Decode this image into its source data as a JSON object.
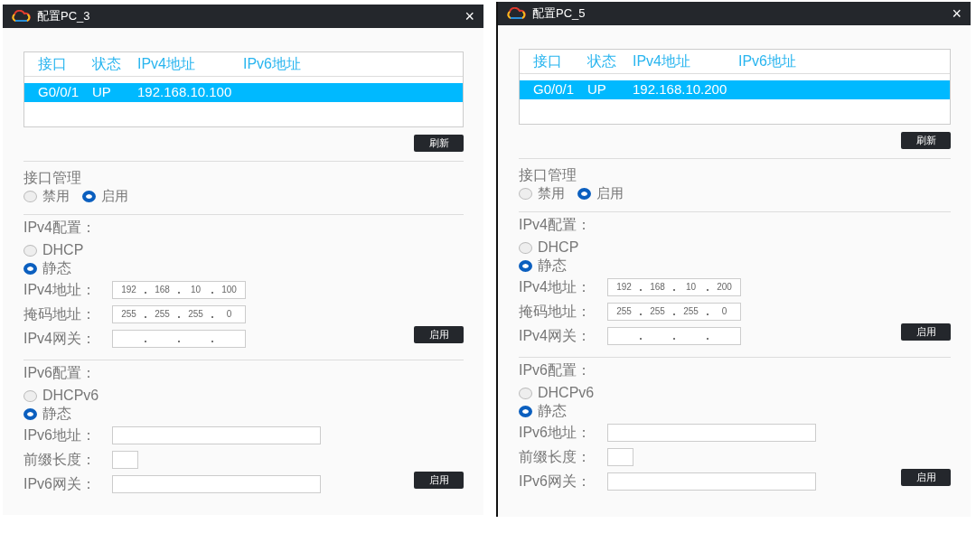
{
  "windows": [
    {
      "title": "配置PC_3",
      "close": "×",
      "table": {
        "columns": [
          "接口",
          "状态",
          "IPv4地址",
          "IPv6地址"
        ],
        "rows": [
          {
            "cells": [
              "G0/0/1",
              "UP",
              "192.168.10.100"
            ],
            "selected": true
          }
        ]
      },
      "refresh_button": "刷新",
      "interface_management": {
        "heading": "接口管理",
        "options": [
          {
            "label": "禁用",
            "selected": false
          },
          {
            "label": "启用",
            "selected": true
          }
        ]
      },
      "ipv4": {
        "heading": "IPv4配置：",
        "options": [
          {
            "label": "DHCP",
            "selected": false
          },
          {
            "label": "静态",
            "selected": true
          }
        ],
        "fields": [
          {
            "label": "IPv4地址：",
            "kind": "ip",
            "octets": [
              "192",
              "168",
              "10",
              "100"
            ]
          },
          {
            "label": "掩码地址：",
            "kind": "ip",
            "octets": [
              "255",
              "255",
              "255",
              "0"
            ]
          },
          {
            "label": "IPv4网关：",
            "kind": "ip"
          }
        ],
        "apply_button": "启用"
      },
      "ipv6": {
        "heading": "IPv6配置：",
        "options": [
          {
            "label": "DHCPv6",
            "selected": false
          },
          {
            "label": "静态",
            "selected": true
          }
        ],
        "fields": [
          {
            "label": "IPv6地址：",
            "kind": "wide"
          },
          {
            "label": "前缀长度：",
            "kind": "short"
          },
          {
            "label": "IPv6网关：",
            "kind": "wide"
          }
        ],
        "apply_button": "启用"
      }
    },
    {
      "title": "配置PC_5",
      "close": "×",
      "table": {
        "columns": [
          "接口",
          "状态",
          "IPv4地址",
          "IPv6地址"
        ],
        "rows": [
          {
            "cells": [
              "G0/0/1",
              "UP",
              "192.168.10.200"
            ],
            "selected": true
          }
        ]
      },
      "refresh_button": "刷新",
      "interface_management": {
        "heading": "接口管理",
        "options": [
          {
            "label": "禁用",
            "selected": false
          },
          {
            "label": "启用",
            "selected": true
          }
        ]
      },
      "ipv4": {
        "heading": "IPv4配置：",
        "options": [
          {
            "label": "DHCP",
            "selected": false
          },
          {
            "label": "静态",
            "selected": true
          }
        ],
        "fields": [
          {
            "label": "IPv4地址：",
            "kind": "ip",
            "octets": [
              "192",
              "168",
              "10",
              "200"
            ]
          },
          {
            "label": "掩码地址：",
            "kind": "ip",
            "octets": [
              "255",
              "255",
              "255",
              "0"
            ]
          },
          {
            "label": "IPv4网关：",
            "kind": "ip"
          }
        ],
        "apply_button": "启用"
      },
      "ipv6": {
        "heading": "IPv6配置：",
        "options": [
          {
            "label": "DHCPv6",
            "selected": false
          },
          {
            "label": "静态",
            "selected": true
          }
        ],
        "fields": [
          {
            "label": "IPv6地址：",
            "kind": "wide"
          },
          {
            "label": "前缀长度：",
            "kind": "short"
          },
          {
            "label": "IPv6网关：",
            "kind": "wide"
          }
        ],
        "apply_button": "启用"
      }
    }
  ]
}
